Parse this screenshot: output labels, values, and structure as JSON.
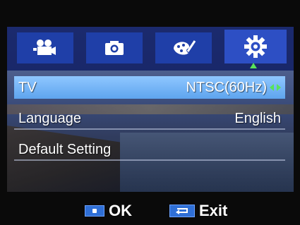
{
  "menu": {
    "tabs": [
      {
        "icon": "video-camera-icon"
      },
      {
        "icon": "photo-camera-icon"
      },
      {
        "icon": "palette-icon"
      },
      {
        "icon": "gear-icon",
        "active": true
      }
    ],
    "rows": [
      {
        "label": "TV",
        "value": "NTSC(60Hz)",
        "selected": true
      },
      {
        "label": "Language",
        "value": "English"
      },
      {
        "label": "Default Setting",
        "value": ""
      }
    ]
  },
  "footer": {
    "ok_label": "OK",
    "exit_label": "Exit"
  },
  "colors": {
    "tab_bg": "#1f3fa8",
    "tab_active": "#2d4fc4",
    "selected_row": "#6fb3f7",
    "key_blue": "#2f6fd6",
    "indicator_green": "#58e45a"
  }
}
